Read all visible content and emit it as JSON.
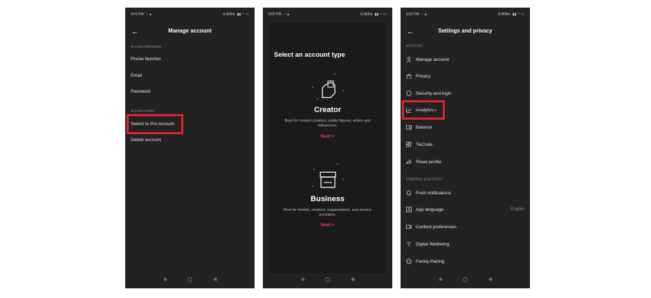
{
  "screens": [
    {
      "status": {
        "time": "9:01 PM",
        "speed": "4.3KB/s"
      },
      "title": "Manage account",
      "section_account_info": "Account information",
      "rows": [
        "Phone Number",
        "Email",
        "Password"
      ],
      "section_account_control": "Account control",
      "switch_pro": "Switch to Pro Account",
      "delete_account": "Delete account"
    },
    {
      "status": {
        "time": "9:02 PM",
        "speed": "8.3KB/s"
      },
      "heading": "Select an account type",
      "creator": {
        "title": "Creator",
        "desc": "Best for content creators, public figures, artists and influencers.",
        "next": "Next >"
      },
      "business": {
        "title": "Business",
        "desc": "Best for brands, retailers, organizations, and service providers.",
        "next": "Next >"
      }
    },
    {
      "status": {
        "time": "9:02 PM",
        "speed": "8.9KB/s"
      },
      "title": "Settings and privacy",
      "section_account": "ACCOUNT",
      "account_items": [
        {
          "label": "Manage account",
          "icon": "person-icon"
        },
        {
          "label": "Privacy",
          "icon": "lock-icon"
        },
        {
          "label": "Security and login",
          "icon": "shield-icon"
        },
        {
          "label": "Analytics",
          "icon": "chart-icon"
        },
        {
          "label": "Balance",
          "icon": "wallet-icon"
        },
        {
          "label": "TikCode",
          "icon": "qr-icon"
        },
        {
          "label": "Share profile",
          "icon": "share-icon"
        }
      ],
      "section_content": "CONTENT & ACTIVITY",
      "content_items": [
        {
          "label": "Push notifications",
          "icon": "bell-icon"
        },
        {
          "label": "App language",
          "icon": "language-icon",
          "value": "English"
        },
        {
          "label": "Content preferences",
          "icon": "video-icon"
        },
        {
          "label": "Digital Wellbeing",
          "icon": "wellbeing-icon"
        },
        {
          "label": "Family Pairing",
          "icon": "family-icon"
        }
      ]
    }
  ],
  "colors": {
    "background": "#222222",
    "highlight": "#e5222d",
    "accent": "#ff3b5c"
  }
}
